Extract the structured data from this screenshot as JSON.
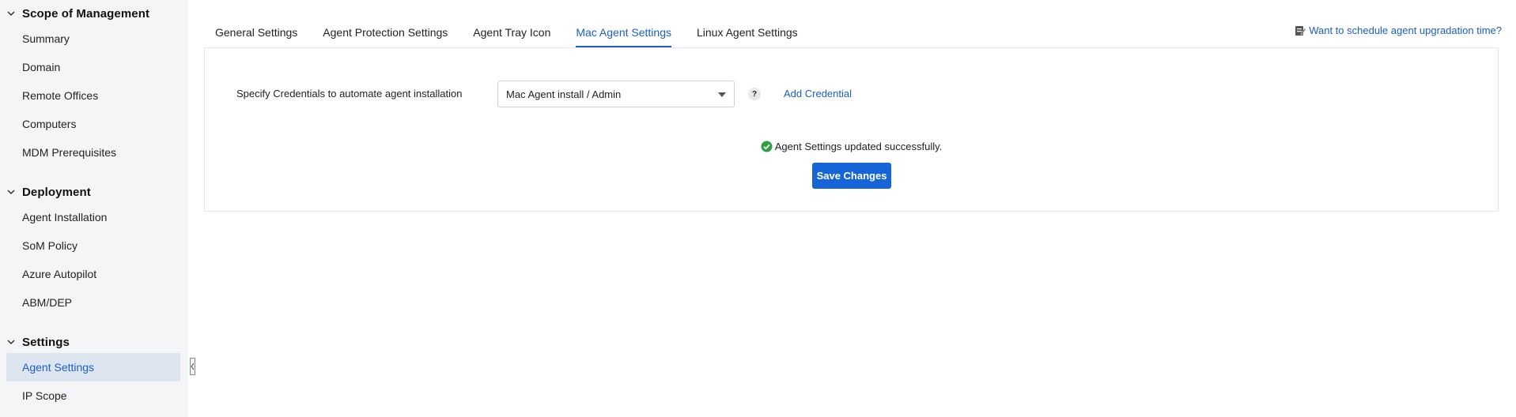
{
  "sidebar": {
    "sections": [
      {
        "title": "Scope of Management",
        "items": [
          "Summary",
          "Domain",
          "Remote Offices",
          "Computers",
          "MDM Prerequisites"
        ]
      },
      {
        "title": "Deployment",
        "items": [
          "Agent Installation",
          "SoM Policy",
          "Azure Autopilot",
          "ABM/DEP"
        ]
      },
      {
        "title": "Settings",
        "items": [
          "Agent Settings",
          "IP Scope"
        ]
      }
    ],
    "active_item": "Agent Settings"
  },
  "tabs": [
    {
      "label": "General Settings",
      "active": false
    },
    {
      "label": "Agent Protection Settings",
      "active": false
    },
    {
      "label": "Agent Tray Icon",
      "active": false
    },
    {
      "label": "Mac Agent Settings",
      "active": true
    },
    {
      "label": "Linux Agent Settings",
      "active": false
    }
  ],
  "schedule_link": "Want to schedule agent upgradation time?",
  "panel": {
    "credential_label": "Specify Credentials to automate agent installation",
    "credential_selected": "Mac Agent install / Admin",
    "help_glyph": "?",
    "add_credential": "Add Credential",
    "success_message": "Agent Settings updated successfully.",
    "save_button": "Save Changes"
  },
  "colors": {
    "accent": "#1a5fc9",
    "button": "#1565d8",
    "success": "#2ea043",
    "sidebar_bg": "#f4f5f7",
    "active_item_bg": "#dde6f0"
  },
  "icons": {
    "section_toggle": "chevron-down-icon",
    "schedule": "calendar-edit-icon",
    "success": "check-circle-icon",
    "dropdown": "caret-down-icon",
    "collapse": "chevron-left-icon"
  }
}
